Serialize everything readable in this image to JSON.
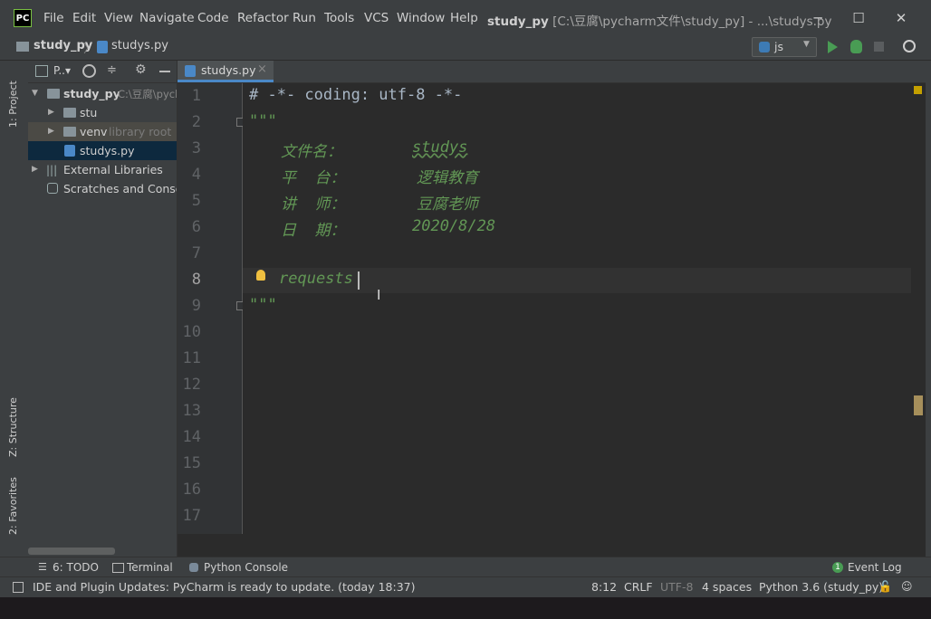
{
  "app": {
    "logo": "PC",
    "window_title_project": "study_py",
    "window_title_path": "[C:\\豆腐\\pycharm文件\\study_py] - ...\\studys.py"
  },
  "menu": [
    "File",
    "Edit",
    "View",
    "Navigate",
    "Code",
    "Refactor",
    "Run",
    "Tools",
    "VCS",
    "Window",
    "Help"
  ],
  "window_controls": {
    "minimize": "─",
    "maximize": "☐",
    "close": "✕"
  },
  "navbar": {
    "breadcrumb_project": "study_py",
    "breadcrumb_sep": "〉",
    "breadcrumb_file": "studys.py",
    "run_config": "js"
  },
  "left_tabs": {
    "project": "1: Project",
    "structure": "Z: Structure",
    "favorites": "2: Favorites"
  },
  "project_panel": {
    "header_label": "P..▾",
    "tree": [
      {
        "name": "study_py",
        "hint": "C:\\豆腐\\pycharm文件\\study_py"
      },
      {
        "name": "stu",
        "hint": ""
      },
      {
        "name": "venv",
        "hint": "library root"
      },
      {
        "name": "studys.py",
        "hint": ""
      },
      {
        "name": "External Libraries",
        "hint": ""
      },
      {
        "name": "Scratches and Consoles",
        "hint": ""
      }
    ]
  },
  "editor": {
    "tab_label": "studys.py",
    "tab_close": "×",
    "line_numbers": [
      "1",
      "2",
      "3",
      "4",
      "5",
      "6",
      "7",
      "8",
      "9",
      "10",
      "11",
      "12",
      "13",
      "14",
      "15",
      "16",
      "17"
    ],
    "current_line": "8",
    "lines": {
      "l1": "# -*- coding: utf-8 -*-",
      "l2": "\"\"\"",
      "l3a": "文件名：",
      "l3b": "studys",
      "l4a": "平  台：",
      "l4b": "逻辑教育",
      "l5a": "讲  师：",
      "l5b": "豆腐老师",
      "l6a": "日  期：",
      "l6b": "2020/8/28",
      "l8": "requests",
      "l9": "\"\"\""
    }
  },
  "bottom_tools": {
    "todo": "6: TODO",
    "terminal": "Terminal",
    "python_console": "Python Console",
    "event_log": "Event Log",
    "event_count": "1"
  },
  "status": {
    "message": "IDE and Plugin Updates: PyCharm is ready to update. (today 18:37)",
    "position": "8:12",
    "line_sep": "CRLF",
    "encoding": "UTF-8",
    "indent": "4 spaces",
    "interpreter": "Python 3.6 (study_py)"
  },
  "colors": {
    "accent": "#4a88c7",
    "run_green": "#499c54",
    "docstring": "#629755",
    "bulb": "#f0c040"
  }
}
